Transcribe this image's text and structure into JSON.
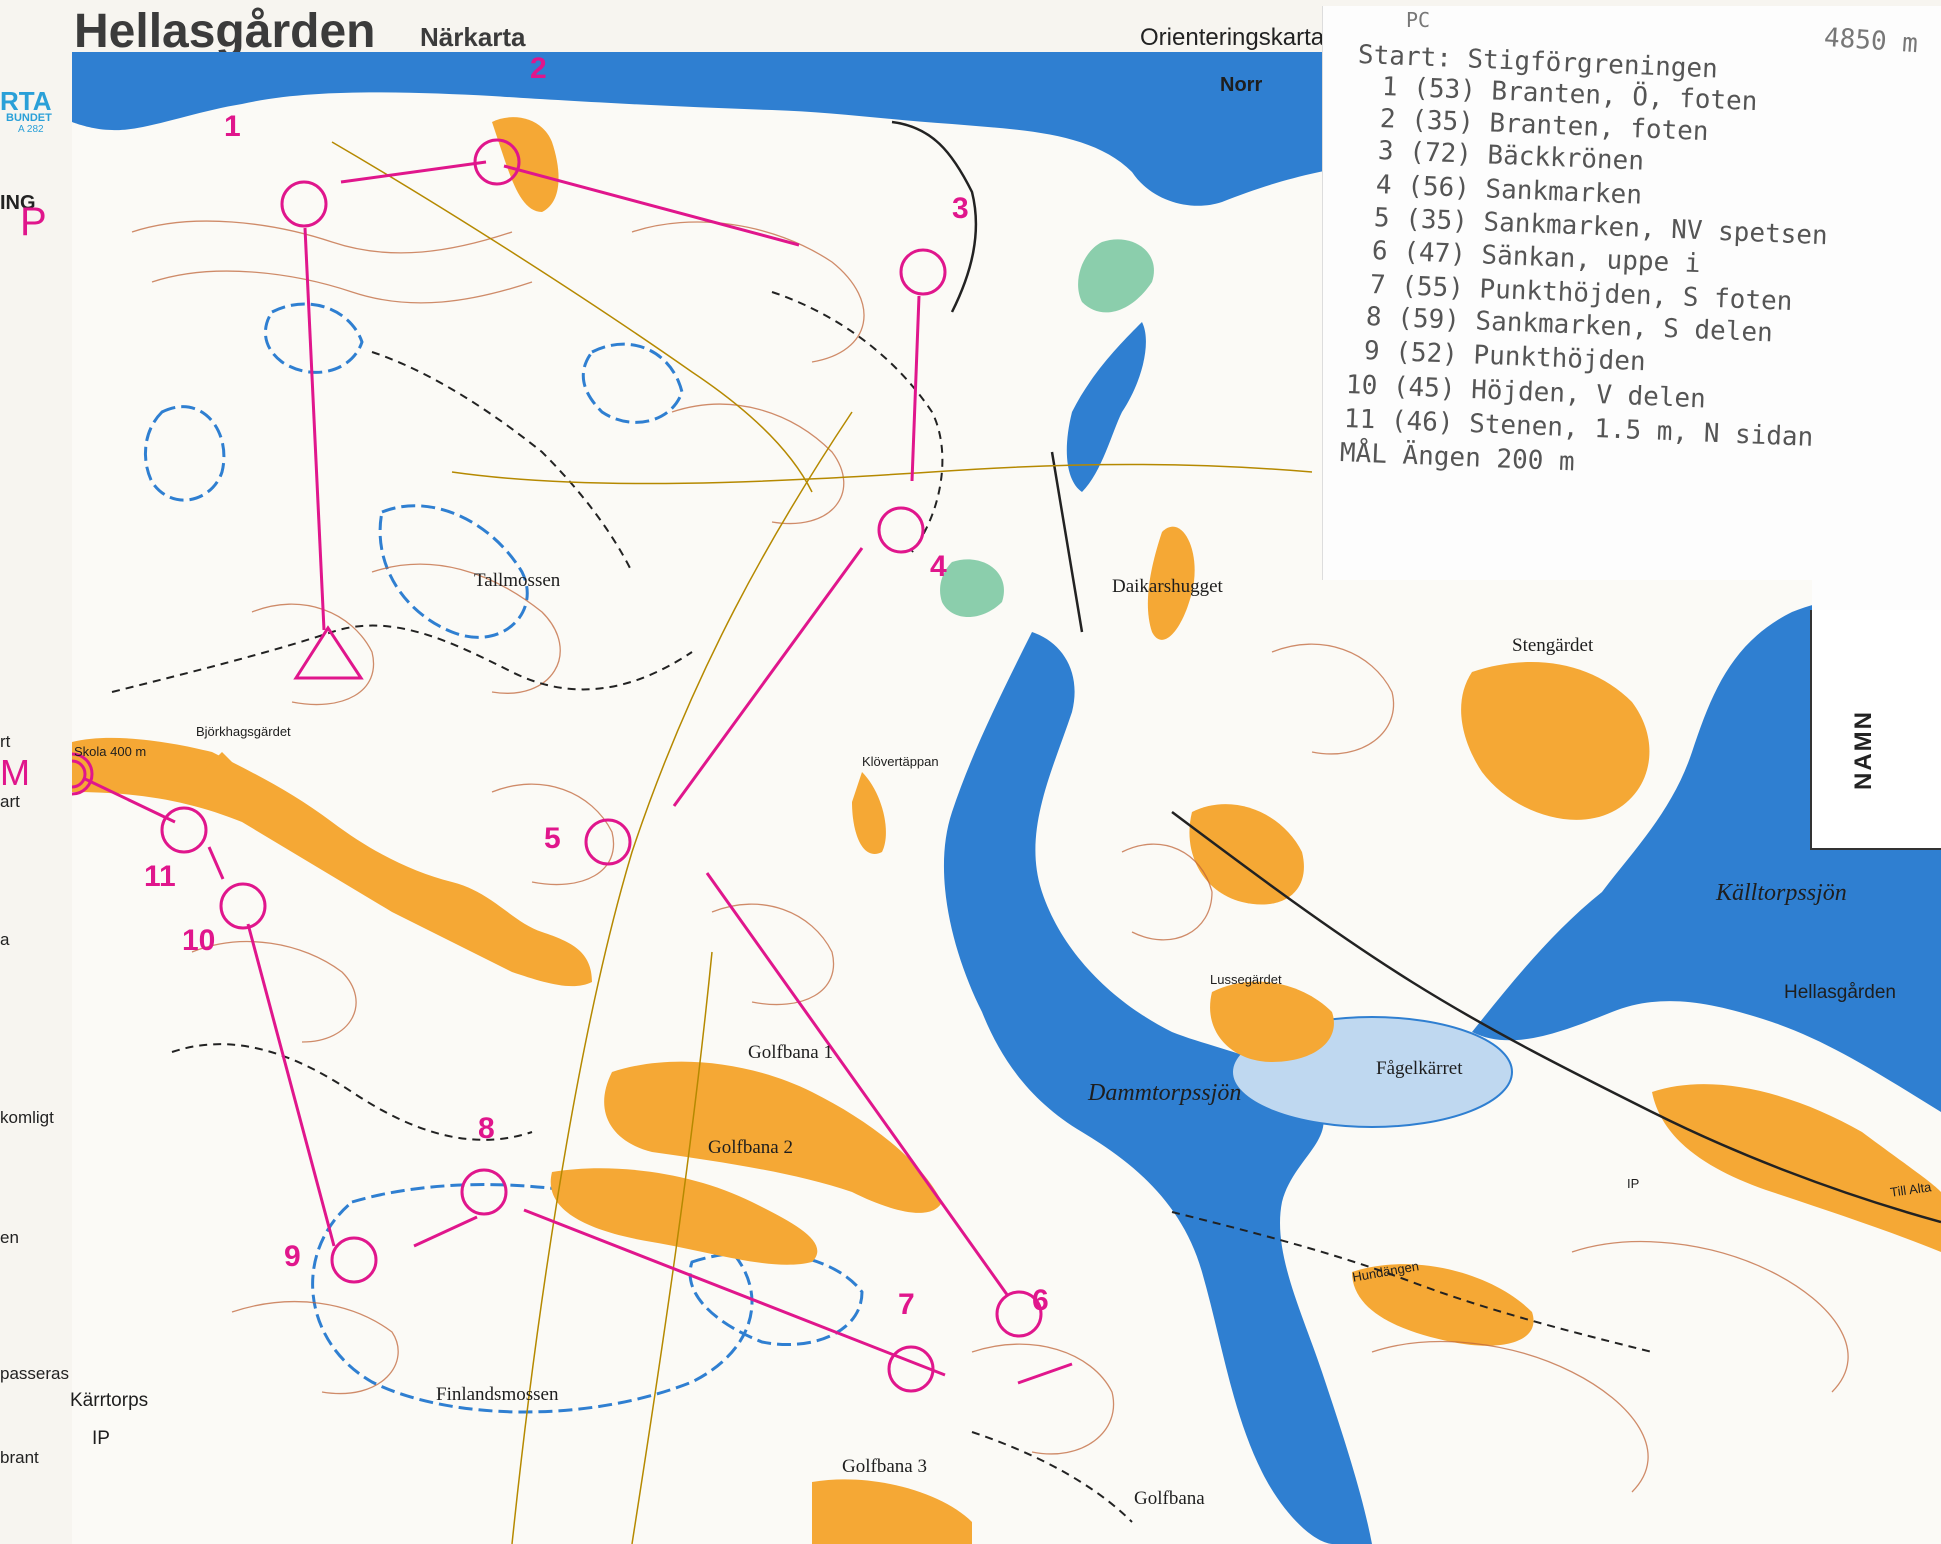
{
  "header": {
    "title": "Hellasgården",
    "subtitle": "Närkarta",
    "map_type": "Orienteringskarta"
  },
  "brand": {
    "logo_fragment": "RTA",
    "org_fragment": "BUNDET",
    "code": "A 282"
  },
  "legend_fragments": [
    {
      "text": "ING"
    },
    {
      "text": "rt"
    },
    {
      "text": "art"
    },
    {
      "text": "a"
    },
    {
      "text": "komligt"
    },
    {
      "text": "en"
    },
    {
      "text": "passeras"
    },
    {
      "text": "brant"
    }
  ],
  "margin_marks": {
    "pc": "P C",
    "m": "M"
  },
  "north_label": "Norr",
  "control_description_sheet": {
    "header_code": "PC",
    "length": "4850 m",
    "start": {
      "label": "Start:",
      "text": "Stigförgreningen"
    },
    "controls": [
      {
        "number": "1",
        "code": "(53)",
        "text": "Branten, Ö, foten"
      },
      {
        "number": "2",
        "code": "(35)",
        "text": "Branten, foten"
      },
      {
        "number": "3",
        "code": "(72)",
        "text": "Bäckkrönen"
      },
      {
        "number": "4",
        "code": "(56)",
        "text": "Sankmarken"
      },
      {
        "number": "5",
        "code": "(35)",
        "text": "Sankmarken, NV spetsen"
      },
      {
        "number": "6",
        "code": "(47)",
        "text": "Sänkan, uppe i"
      },
      {
        "number": "7",
        "code": "(55)",
        "text": "Punkthöjden, S foten"
      },
      {
        "number": "8",
        "code": "(59)",
        "text": "Sankmarken, S delen"
      },
      {
        "number": "9",
        "code": "(52)",
        "text": "Punkthöjden"
      },
      {
        "number": "10",
        "code": "(45)",
        "text": "Höjden, V delen"
      },
      {
        "number": "11",
        "code": "(46)",
        "text": "Stenen, 1.5 m, N sidan"
      }
    ],
    "finish": {
      "label": "MÅL",
      "text": "Ängen 200 m"
    }
  },
  "namn_label": "NAMN",
  "place_names": [
    {
      "id": "tallmossen",
      "text": "Tallmossen"
    },
    {
      "id": "daikarshugget",
      "text": "Daikarshugget"
    },
    {
      "id": "stengardet",
      "text": "Stengärdet"
    },
    {
      "id": "bjorkhagsgardet",
      "text": "Björkhagsgärdet"
    },
    {
      "id": "skola",
      "text": "Skola 400 m"
    },
    {
      "id": "klovertappan",
      "text": "Klövertäppan"
    },
    {
      "id": "kalltorpssjon",
      "text": "Källtorpssjön"
    },
    {
      "id": "hellasgarden",
      "text": "Hellasgården"
    },
    {
      "id": "lussegardet",
      "text": "Lussegärdet"
    },
    {
      "id": "golfbana1",
      "text": "Golfbana 1"
    },
    {
      "id": "golfbana2",
      "text": "Golfbana 2"
    },
    {
      "id": "golfbana3",
      "text": "Golfbana 3"
    },
    {
      "id": "golfbana",
      "text": "Golfbana"
    },
    {
      "id": "dammtorpssjon",
      "text": "Dammtorpssjön"
    },
    {
      "id": "fagelkarret",
      "text": "Fågelkärret"
    },
    {
      "id": "hundangen",
      "text": "Hundängen"
    },
    {
      "id": "finlandsmossen",
      "text": "Finlandsmossen"
    },
    {
      "id": "karrtorps",
      "text": "Kärrtorps"
    },
    {
      "id": "ip_left",
      "text": "IP"
    },
    {
      "id": "ip_right",
      "text": "IP"
    },
    {
      "id": "till_alta",
      "text": "Till Alta"
    }
  ],
  "course": {
    "color": "#e0168c",
    "legs": [
      {
        "from": "start",
        "to": "1"
      },
      {
        "from": "1",
        "to": "2"
      },
      {
        "from": "2",
        "to": "3"
      },
      {
        "from": "3",
        "to": "4"
      },
      {
        "from": "4",
        "to": "5"
      },
      {
        "from": "5",
        "to": "6"
      },
      {
        "from": "6",
        "to": "7"
      },
      {
        "from": "7",
        "to": "8"
      },
      {
        "from": "8",
        "to": "9"
      },
      {
        "from": "9",
        "to": "10"
      },
      {
        "from": "10",
        "to": "11"
      },
      {
        "from": "11",
        "to": "finish"
      }
    ],
    "control_labels": [
      "1",
      "2",
      "3",
      "4",
      "5",
      "6",
      "7",
      "8",
      "9",
      "10",
      "11"
    ]
  },
  "colors": {
    "water": "#2f7fd1",
    "open_land": "#f5a835",
    "contour": "#b0502a",
    "marsh": "#2f7fd1",
    "course": "#e0168c",
    "paper": "#f7f5f0"
  }
}
